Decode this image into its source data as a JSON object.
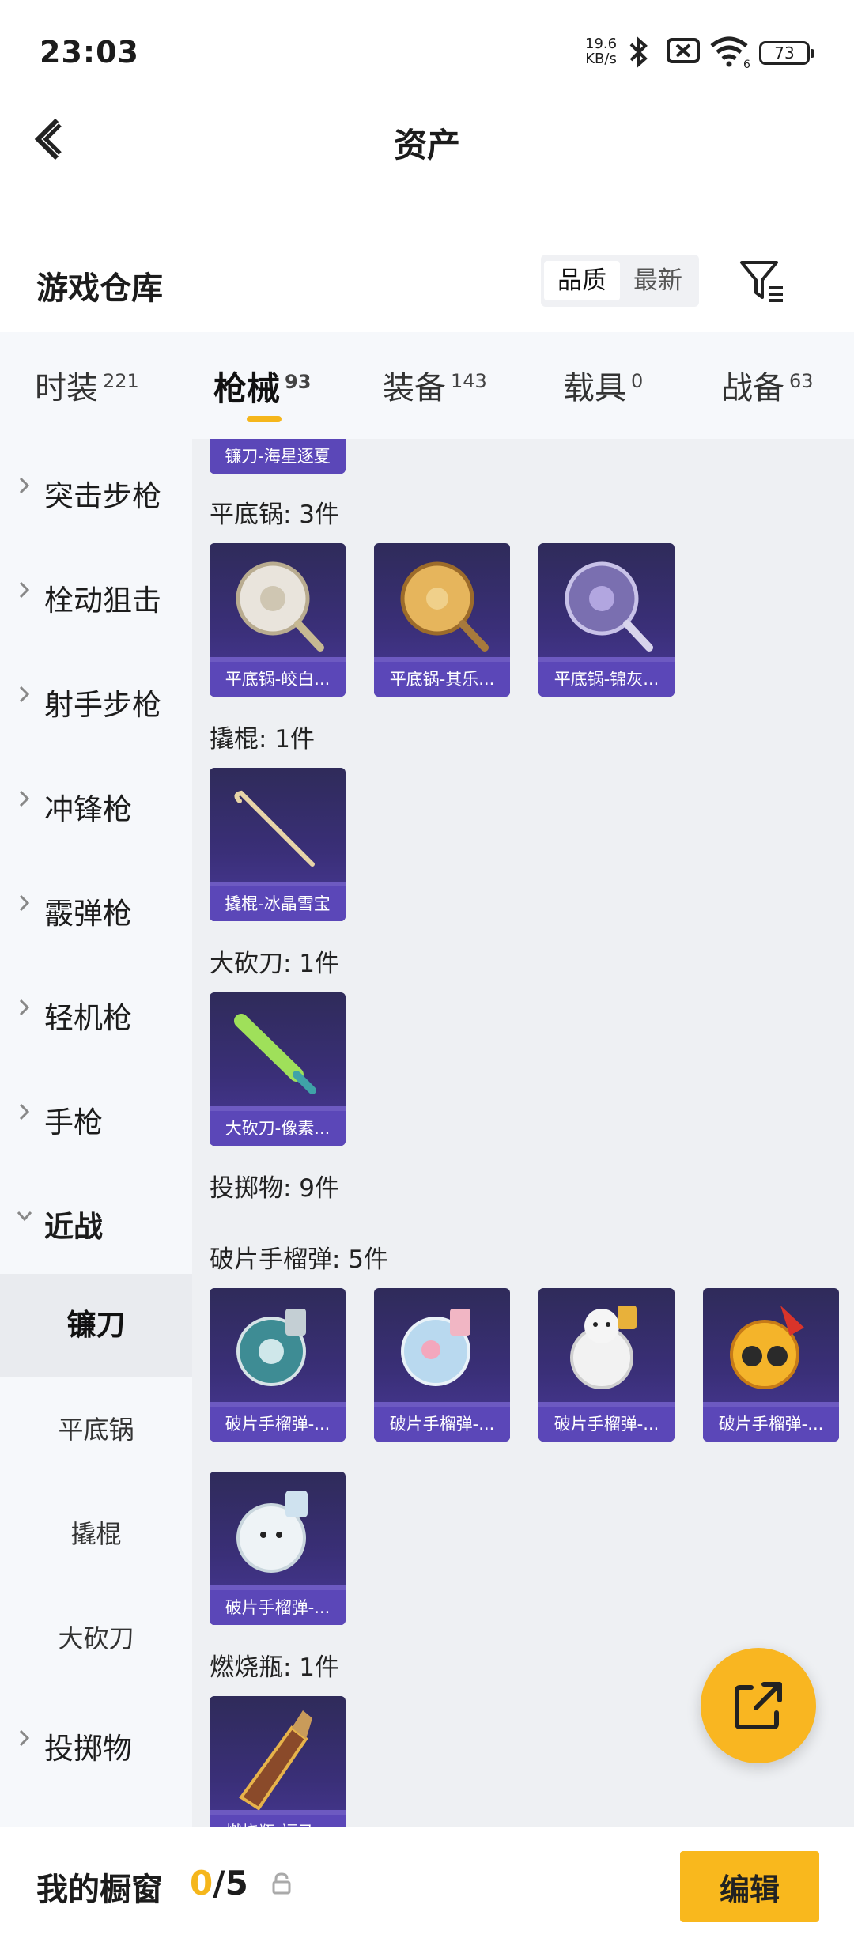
{
  "status": {
    "time": "23:03",
    "speed_value": "19.6",
    "speed_unit": "KB/s",
    "battery": "73",
    "wifi_label": "6"
  },
  "header": {
    "title": "资产"
  },
  "warehouse": {
    "title": "游戏仓库",
    "sort_options": [
      "品质",
      "最新"
    ],
    "active_sort": "品质"
  },
  "tabs": [
    {
      "label": "时装",
      "count": "221"
    },
    {
      "label": "枪械",
      "count": "93",
      "active": true
    },
    {
      "label": "装备",
      "count": "143"
    },
    {
      "label": "载具",
      "count": "0"
    },
    {
      "label": "战备",
      "count": "63"
    }
  ],
  "sidebar": {
    "categories": [
      "突击步枪",
      "栓动狙击",
      "射手步枪",
      "冲锋枪",
      "霰弹枪",
      "轻机枪",
      "手枪",
      "近战",
      "投掷物"
    ],
    "expanded": "近战",
    "subitems": [
      "镰刀",
      "平底锅",
      "撬棍",
      "大砍刀"
    ],
    "active_sub": "镰刀"
  },
  "content": {
    "top_card": "镰刀-海星逐夏",
    "sections": [
      {
        "title": "平底锅: 3件",
        "items": [
          "平底锅-皎白...",
          "平底锅-其乐...",
          "平底锅-锦灰..."
        ]
      },
      {
        "title": "撬棍: 1件",
        "items": [
          "撬棍-冰晶雪宝"
        ]
      },
      {
        "title": "大砍刀: 1件",
        "items": [
          "大砍刀-像素..."
        ]
      },
      {
        "title": "投掷物: 9件"
      },
      {
        "title": "破片手榴弹: 5件",
        "items": [
          "破片手榴弹-...",
          "破片手榴弹-...",
          "破片手榴弹-...",
          "破片手榴弹-...",
          "破片手榴弹-..."
        ]
      },
      {
        "title": "燃烧瓶: 1件",
        "items": [
          "燃烧瓶-福马..."
        ]
      }
    ]
  },
  "bottom": {
    "label": "我的橱窗",
    "used": "0",
    "total": "/5",
    "edit": "编辑"
  },
  "colors": {
    "accent": "#f5b61b",
    "card_bg": "#3a2f78",
    "card_label": "#5b47b8"
  },
  "icons": [
    "back-arrow-icon",
    "bluetooth-icon",
    "sim-off-icon",
    "wifi-icon",
    "battery-icon",
    "filter-icon",
    "chevron-right-icon",
    "chevron-down-icon",
    "share-out-icon",
    "lock-icon"
  ]
}
